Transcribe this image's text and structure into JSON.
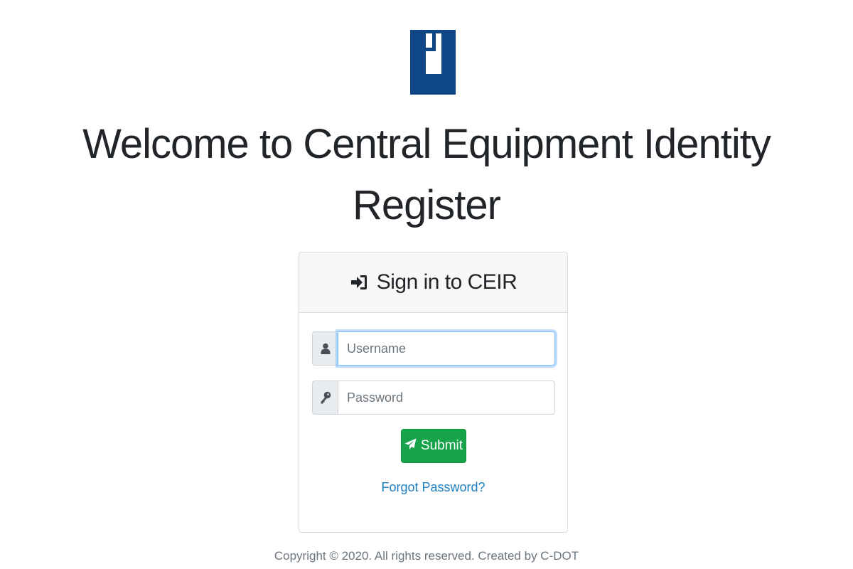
{
  "page": {
    "title": "Welcome to Central Equipment Identity Register"
  },
  "logo": {
    "icon": "ceir-logo-icon",
    "color": "#0e4686"
  },
  "login_card": {
    "header_icon": "sign-in-icon",
    "header_title": "Sign in to CEIR",
    "username": {
      "icon": "user-icon",
      "placeholder": "Username",
      "value": ""
    },
    "password": {
      "icon": "key-icon",
      "placeholder": "Password",
      "value": ""
    },
    "submit": {
      "icon": "paper-plane-icon",
      "label": "Submit",
      "color": "#17a34a"
    },
    "forgot_link": "Forgot Password?"
  },
  "footer": {
    "text": "Copyright © 2020. All rights reserved. Created by C-DOT"
  }
}
